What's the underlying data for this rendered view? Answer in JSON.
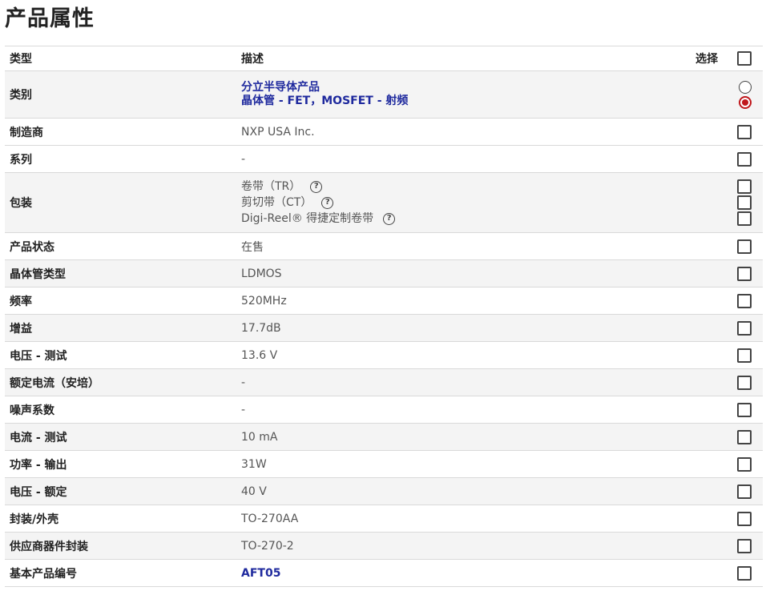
{
  "page_title": "产品属性",
  "table": {
    "header": {
      "type": "类型",
      "description": "描述",
      "select": "选择"
    },
    "rows": [
      {
        "label": "类别",
        "values": [
          "分立半导体产品",
          "晶体管 - FET，MOSFET - 射频"
        ],
        "value_style": "link",
        "selector": "radio",
        "radio_options": [
          {
            "checked": false
          },
          {
            "checked": true
          }
        ]
      },
      {
        "label": "制造商",
        "value": "NXP USA Inc."
      },
      {
        "label": "系列",
        "value": "-"
      },
      {
        "label": "包装",
        "packaging": [
          {
            "text": "卷带（TR）",
            "help_icon": "question-circle-icon"
          },
          {
            "text": "剪切带（CT）",
            "help_icon": "question-circle-icon"
          },
          {
            "text": "Digi-Reel® 得捷定制卷带",
            "help_icon": "question-circle-icon"
          }
        ]
      },
      {
        "label": "产品状态",
        "value": "在售"
      },
      {
        "label": "晶体管类型",
        "value": "LDMOS"
      },
      {
        "label": "频率",
        "value": "520MHz"
      },
      {
        "label": "增益",
        "value": "17.7dB"
      },
      {
        "label": "电压 - 测试",
        "value": "13.6 V"
      },
      {
        "label": "额定电流（安培）",
        "value": "-"
      },
      {
        "label": "噪声系数",
        "value": "-"
      },
      {
        "label": "电流 - 测试",
        "value": "10 mA"
      },
      {
        "label": "功率 - 输出",
        "value": "31W"
      },
      {
        "label": "电压 - 额定",
        "value": "40 V"
      },
      {
        "label": "封装/外壳",
        "value": "TO-270AA"
      },
      {
        "label": "供应商器件封装",
        "value": "TO-270-2"
      },
      {
        "label": "基本产品编号",
        "value": "AFT05",
        "value_style": "link"
      }
    ]
  },
  "colors": {
    "link": "#1f2a9e",
    "radio_checked": "#c0181c",
    "row_alt_bg": "#f4f4f4",
    "border": "#d9d9d9"
  }
}
